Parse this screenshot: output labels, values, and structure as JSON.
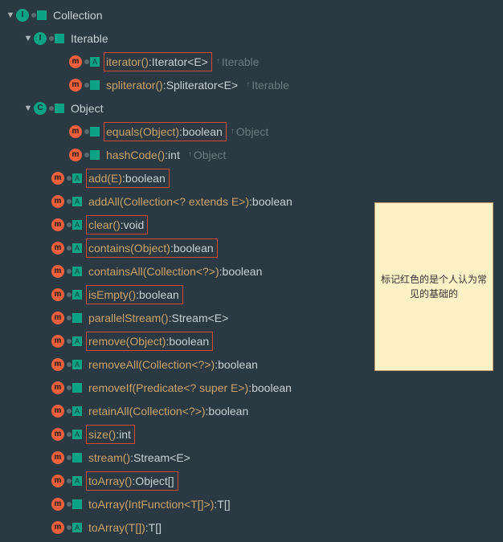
{
  "note": "标记红色的是个人认为常见的基础的",
  "root": {
    "name": "Collection",
    "icon": "I",
    "badge": ""
  },
  "nodes": [
    {
      "level": 1,
      "kind": "iface",
      "chevron": "down",
      "icon": "I",
      "badge": "",
      "name": "Iterable",
      "type": "",
      "origin": "",
      "boxed": false
    },
    {
      "level": 3,
      "kind": "method",
      "chevron": "none",
      "icon": "m",
      "badge": "A",
      "name": "iterator()",
      "type": "Iterator<E>",
      "origin": "Iterable",
      "boxed": true
    },
    {
      "level": 3,
      "kind": "method",
      "chevron": "none",
      "icon": "m",
      "badge": "",
      "name": "spliterator()",
      "type": "Spliterator<E>",
      "origin": "Iterable",
      "boxed": false
    },
    {
      "level": 1,
      "kind": "iface",
      "chevron": "down",
      "icon": "C",
      "badge": "",
      "name": "Object",
      "type": "",
      "origin": "",
      "boxed": false
    },
    {
      "level": 3,
      "kind": "method",
      "chevron": "none",
      "icon": "m",
      "badge": "",
      "name": "equals(Object)",
      "type": "boolean",
      "origin": "Object",
      "boxed": true
    },
    {
      "level": 3,
      "kind": "method",
      "chevron": "none",
      "icon": "m",
      "badge": "",
      "name": "hashCode()",
      "type": "int",
      "origin": "Object",
      "boxed": false
    },
    {
      "level": 2,
      "kind": "method",
      "chevron": "none",
      "icon": "m",
      "badge": "A",
      "name": "add(E)",
      "type": "boolean",
      "origin": "",
      "boxed": true
    },
    {
      "level": 2,
      "kind": "method",
      "chevron": "none",
      "icon": "m",
      "badge": "A",
      "name": "addAll(Collection<? extends E>)",
      "type": "boolean",
      "origin": "",
      "boxed": false
    },
    {
      "level": 2,
      "kind": "method",
      "chevron": "none",
      "icon": "m",
      "badge": "A",
      "name": "clear()",
      "type": "void",
      "origin": "",
      "boxed": true
    },
    {
      "level": 2,
      "kind": "method",
      "chevron": "none",
      "icon": "m",
      "badge": "A",
      "name": "contains(Object)",
      "type": "boolean",
      "origin": "",
      "boxed": true
    },
    {
      "level": 2,
      "kind": "method",
      "chevron": "none",
      "icon": "m",
      "badge": "A",
      "name": "containsAll(Collection<?>)",
      "type": "boolean",
      "origin": "",
      "boxed": false
    },
    {
      "level": 2,
      "kind": "method",
      "chevron": "none",
      "icon": "m",
      "badge": "A",
      "name": "isEmpty()",
      "type": "boolean",
      "origin": "",
      "boxed": true
    },
    {
      "level": 2,
      "kind": "method",
      "chevron": "none",
      "icon": "m",
      "badge": "",
      "name": "parallelStream()",
      "type": "Stream<E>",
      "origin": "",
      "boxed": false
    },
    {
      "level": 2,
      "kind": "method",
      "chevron": "none",
      "icon": "m",
      "badge": "A",
      "name": "remove(Object)",
      "type": "boolean",
      "origin": "",
      "boxed": true
    },
    {
      "level": 2,
      "kind": "method",
      "chevron": "none",
      "icon": "m",
      "badge": "A",
      "name": "removeAll(Collection<?>)",
      "type": "boolean",
      "origin": "",
      "boxed": false
    },
    {
      "level": 2,
      "kind": "method",
      "chevron": "none",
      "icon": "m",
      "badge": "",
      "name": "removeIf(Predicate<? super E>)",
      "type": "boolean",
      "origin": "",
      "boxed": false
    },
    {
      "level": 2,
      "kind": "method",
      "chevron": "none",
      "icon": "m",
      "badge": "A",
      "name": "retainAll(Collection<?>)",
      "type": "boolean",
      "origin": "",
      "boxed": false
    },
    {
      "level": 2,
      "kind": "method",
      "chevron": "none",
      "icon": "m",
      "badge": "A",
      "name": "size()",
      "type": "int",
      "origin": "",
      "boxed": true
    },
    {
      "level": 2,
      "kind": "method",
      "chevron": "none",
      "icon": "m",
      "badge": "",
      "name": "stream()",
      "type": "Stream<E>",
      "origin": "",
      "boxed": false
    },
    {
      "level": 2,
      "kind": "method",
      "chevron": "none",
      "icon": "m",
      "badge": "A",
      "name": "toArray()",
      "type": "Object[]",
      "origin": "",
      "boxed": true
    },
    {
      "level": 2,
      "kind": "method",
      "chevron": "none",
      "icon": "m",
      "badge": "",
      "name": "toArray(IntFunction<T[]>)",
      "type": "T[]",
      "origin": "",
      "boxed": false
    },
    {
      "level": 2,
      "kind": "method",
      "chevron": "none",
      "icon": "m",
      "badge": "A",
      "name": "toArray(T[])",
      "type": "T[]",
      "origin": "",
      "boxed": false
    }
  ]
}
